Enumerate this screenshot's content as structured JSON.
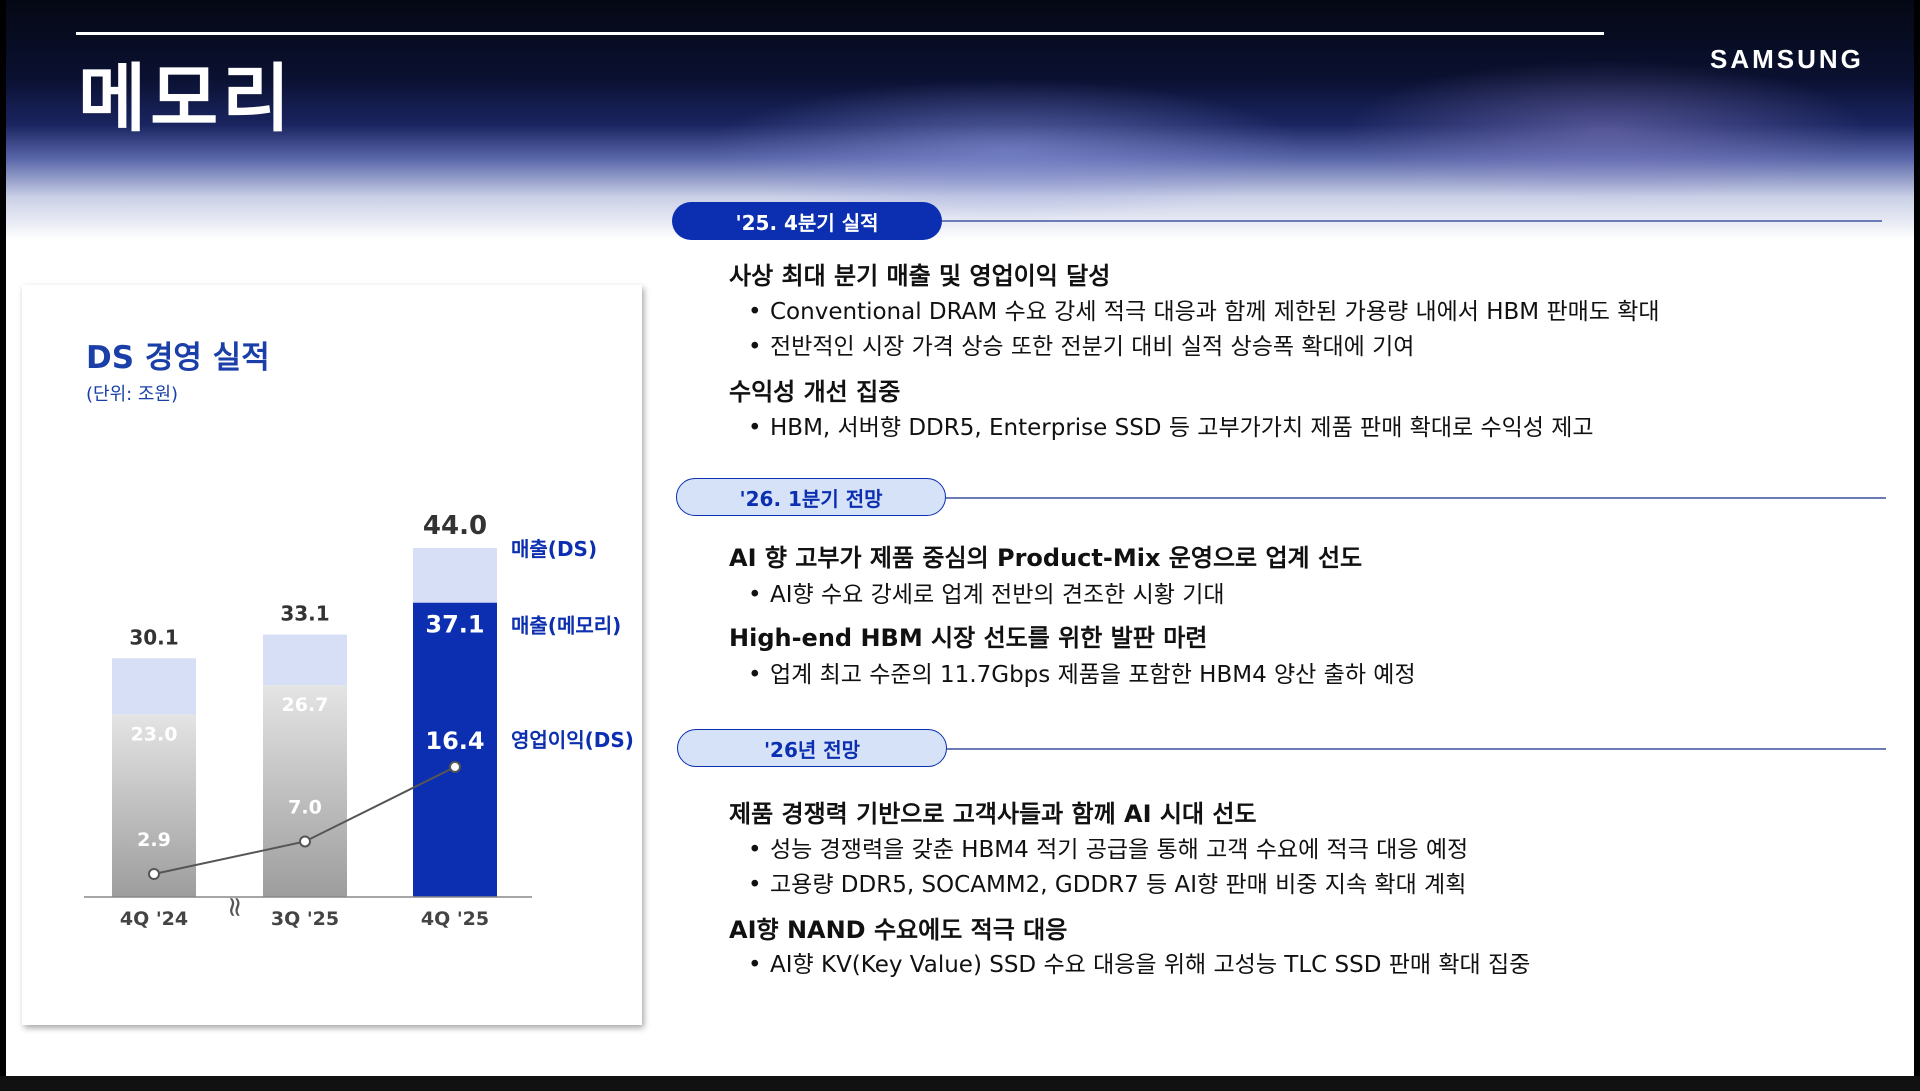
{
  "header": {
    "title": "메모리",
    "brand": "SAMSUNG"
  },
  "chart_panel": {
    "title": "DS 경영 실적",
    "unit": "(단위: 조원)"
  },
  "chart_data": {
    "type": "bar",
    "categories": [
      "4Q '24",
      "3Q '25",
      "4Q '25"
    ],
    "series": [
      {
        "name": "매출(DS)",
        "values": [
          30.1,
          33.1,
          44.0
        ]
      },
      {
        "name": "매출(메모리)",
        "values": [
          23.0,
          26.7,
          37.1
        ]
      },
      {
        "name": "영업이익(DS)",
        "values": [
          2.9,
          7.0,
          16.4
        ]
      }
    ],
    "ylim": [
      0,
      50
    ],
    "axis_break": "≈",
    "colors": {
      "highlight": "#0b2fb0",
      "light": "#d6dff5",
      "grey": "#9d9d9d",
      "line": "#555555"
    }
  },
  "sections": [
    {
      "label": "'25. 4분기 실적",
      "groups": [
        {
          "heading": "사상 최대 분기 매출 및 영업이익 달성",
          "bullets": [
            "Conventional DRAM 수요 강세 적극 대응과 함께 제한된 가용량 내에서 HBM 판매도 확대",
            "전반적인 시장 가격 상승 또한 전분기 대비 실적 상승폭 확대에 기여"
          ]
        },
        {
          "heading": "수익성 개선 집중",
          "bullets": [
            "HBM, 서버향 DDR5, Enterprise SSD 등 고부가가치 제품 판매 확대로 수익성 제고"
          ]
        }
      ]
    },
    {
      "label": "'26. 1분기 전망",
      "groups": [
        {
          "heading": "AI 향 고부가 제품 중심의 Product-Mix 운영으로 업계 선도",
          "bullets": [
            "AI향 수요 강세로 업계 전반의 견조한 시황 기대"
          ]
        },
        {
          "heading": "High-end HBM 시장 선도를 위한 발판 마련",
          "bullets": [
            "업계 최고 수준의 11.7Gbps 제품을 포함한 HBM4 양산 출하 예정"
          ]
        }
      ]
    },
    {
      "label": "'26년 전망",
      "groups": [
        {
          "heading": "제품 경쟁력 기반으로 고객사들과 함께 AI 시대 선도",
          "bullets": [
            "성능 경쟁력을 갖춘 HBM4 적기 공급을 통해 고객 수요에 적극 대응 예정",
            "고용량 DDR5, SOCAMM2, GDDR7 등 AI향 판매 비중 지속 확대 계획"
          ]
        },
        {
          "heading": "AI향 NAND 수요에도 적극 대응",
          "bullets": [
            "AI향 KV(Key Value) SSD 수요 대응을 위해 고성능 TLC SSD 판매 확대 집중"
          ]
        }
      ]
    }
  ],
  "bullet_symbol": "•"
}
